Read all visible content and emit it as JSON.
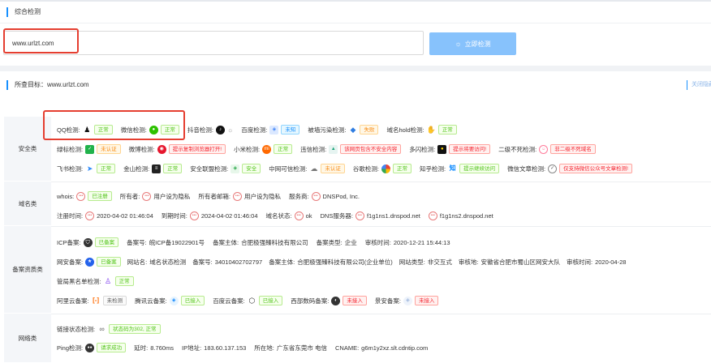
{
  "page": {
    "section_title": "综合检测"
  },
  "search": {
    "value": "www.urlzt.com",
    "button_label": "立即检测"
  },
  "target": {
    "label": "所查目标：",
    "value": "www.urlzt.com",
    "hide_label": "关闭隐藏"
  },
  "categories": {
    "security": "安全类",
    "domain": "域名类",
    "icp": "备案资质类",
    "network": "网络类"
  },
  "security": {
    "row1": [
      {
        "label": "QQ检测:",
        "status": "正常"
      },
      {
        "label": "微信检测:",
        "status": "正常"
      },
      {
        "label": "抖音检测:"
      },
      {
        "label": "百度检测:",
        "status": "未知"
      },
      {
        "label": "被墙污染检测:",
        "status": "失败"
      },
      {
        "label": "域名hold检测:",
        "status": "正常"
      }
    ],
    "row2": [
      {
        "label": "绿标检测:",
        "status": "未认证"
      },
      {
        "label": "微博检测:",
        "status": "提示复制浏览器打开!"
      },
      {
        "label": "小米检测:",
        "status": "正常"
      },
      {
        "label": "违信检测:",
        "status": "该网页包含不安全内容"
      },
      {
        "label": "多闪检测:",
        "status": "提示将要访问!"
      },
      {
        "label": "二级不死检测:",
        "status": "非二级不死域名"
      }
    ],
    "row3": [
      {
        "label": "飞书检测:",
        "status": "正常"
      },
      {
        "label": "金山检测:",
        "status": "正常"
      },
      {
        "label": "安全联盟检测:",
        "status": "安全"
      },
      {
        "label": "中网可信检测:",
        "status": "未认证"
      },
      {
        "label": "谷歌检测:",
        "status": "正常"
      },
      {
        "label": "知乎检测:",
        "status": "提示继续访问"
      },
      {
        "label": "微信文章检测:",
        "status": "仅支持微信公众号文章检测!"
      }
    ]
  },
  "domain": {
    "row1": [
      {
        "label": "whois:",
        "value": "已注册"
      },
      {
        "label": "所有者:",
        "value": "用户设为隐私"
      },
      {
        "label": "所有者邮箱:",
        "value": "用户设为隐私"
      },
      {
        "label": "服务商:",
        "value": "DNSPod, Inc."
      }
    ],
    "row2": [
      {
        "label": "注册时间:",
        "value": "2020-04-02 01:46:04"
      },
      {
        "label": "到期时间:",
        "value": "2024-04-02 01:46:04"
      },
      {
        "label": "域名状态:",
        "value": "ok"
      },
      {
        "label": "DNS服务器:",
        "value": "f1g1ns1.dnspod.net"
      },
      {
        "value": "f1g1ns2.dnspod.net"
      }
    ]
  },
  "icp": {
    "row1": [
      {
        "label": "ICP备案:",
        "value": "已备案"
      },
      {
        "label": "备案号:",
        "value": "皖ICP备19022901号"
      },
      {
        "label": "备案主体:",
        "value": "合肥极强臻科技有限公司"
      },
      {
        "label": "备案类型:",
        "value": "企业"
      },
      {
        "label": "审核时间:",
        "value": "2020-12-21 15:44:13"
      }
    ],
    "row2": [
      {
        "label": "网安备案:",
        "value": "已备案"
      },
      {
        "label": "网站名:",
        "value": "域名状态检测"
      },
      {
        "label": "备案号:",
        "value": "34010402702797"
      },
      {
        "label": "备案主体:",
        "value": "合肥极强臻科技有限公司(企业单位)"
      },
      {
        "label": "网站类型:",
        "value": "非交互式"
      },
      {
        "label": "审核地:",
        "value": "安徽省合肥市蜀山区网安大队"
      },
      {
        "label": "审核时间:",
        "value": "2020-04-28"
      }
    ],
    "row3": [
      {
        "label": "管局黑名单检测:",
        "value": "正常"
      }
    ],
    "row4": [
      {
        "label": "阿里云备案:",
        "value": "未检测"
      },
      {
        "label": "腾讯云备案:",
        "value": "已接入"
      },
      {
        "label": "百度云备案:",
        "value": "已接入"
      },
      {
        "label": "西部数码备案:",
        "value": "未接入"
      },
      {
        "label": "景安备案:",
        "value": "未接入"
      }
    ]
  },
  "network": {
    "row1": [
      {
        "label": "链接状态检测:",
        "value": "状态码为302, 正常"
      }
    ],
    "row2": [
      {
        "label": "Ping检测:",
        "value": "请求成功"
      },
      {
        "label": "延时:",
        "value": "8.760ms"
      },
      {
        "label": "IP地址:",
        "value": "183.60.137.153"
      },
      {
        "label": "所在地:",
        "value": "广东省东莞市 电信"
      },
      {
        "label": "CNAME:",
        "value": "g6m1y2xz.slt.cdntip.com"
      }
    ]
  },
  "colors": {
    "accent": "#1890ff",
    "button": "#87c2fc",
    "ok": "#52c41a",
    "bad": "#f5222d",
    "highlight": "#e53e30"
  }
}
